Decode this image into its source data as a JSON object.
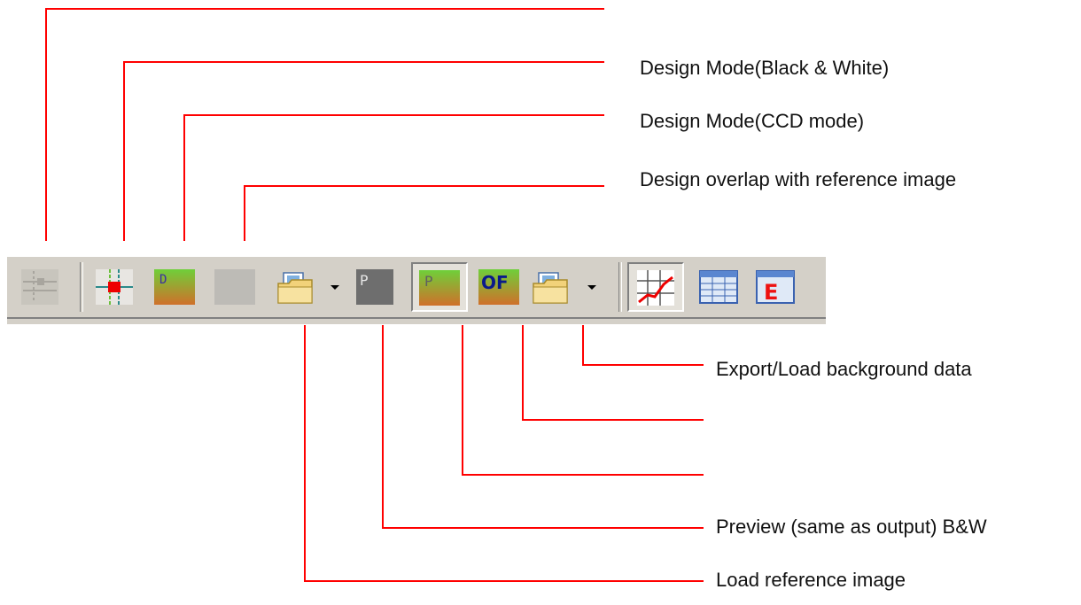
{
  "annotations": [
    {
      "id": "grayed-tool",
      "text": ""
    },
    {
      "id": "design-bw",
      "text": "Design Mode(Black & White)"
    },
    {
      "id": "design-ccd",
      "text": "Design Mode(CCD mode)"
    },
    {
      "id": "design-overlap",
      "text": "Design  overlap with reference image"
    },
    {
      "id": "export-load-bg",
      "text": "Export/Load background  data"
    },
    {
      "id": "load-bg-folder",
      "text": ""
    },
    {
      "id": "preview-color",
      "text": ""
    },
    {
      "id": "preview-bw",
      "text": "Preview (same as output) B&W"
    },
    {
      "id": "load-reference",
      "text": "Load  reference image"
    }
  ],
  "toolbar": {
    "buttons": [
      {
        "name": "grayed-tool-button",
        "icon": "disabled-crosshair-icon"
      },
      {
        "name": "design-bw-button",
        "icon": "crosshair-red-square-icon"
      },
      {
        "name": "design-ccd-button",
        "icon": "green-orange-gradient-d-icon"
      },
      {
        "name": "design-overlap-button",
        "icon": "gray-blank-icon"
      },
      {
        "name": "load-reference-button",
        "icon": "folder-image-icon"
      },
      {
        "name": "preview-bw-button",
        "icon": "gray-p-icon"
      },
      {
        "name": "preview-color-button",
        "icon": "green-orange-gradient-p-icon"
      },
      {
        "name": "of-button",
        "icon": "of-text-icon"
      },
      {
        "name": "load-bg-button",
        "icon": "folder-image-icon"
      },
      {
        "name": "chart-button",
        "icon": "red-line-chart-icon"
      },
      {
        "name": "table-button",
        "icon": "table-window-icon"
      },
      {
        "name": "e-button",
        "icon": "red-e-window-icon"
      }
    ],
    "of_text": "OF",
    "p_text": "P",
    "d_text": "D",
    "e_text": "E"
  },
  "colors": {
    "leader": "#ff0000",
    "toolbar": "#d4d0c8"
  }
}
